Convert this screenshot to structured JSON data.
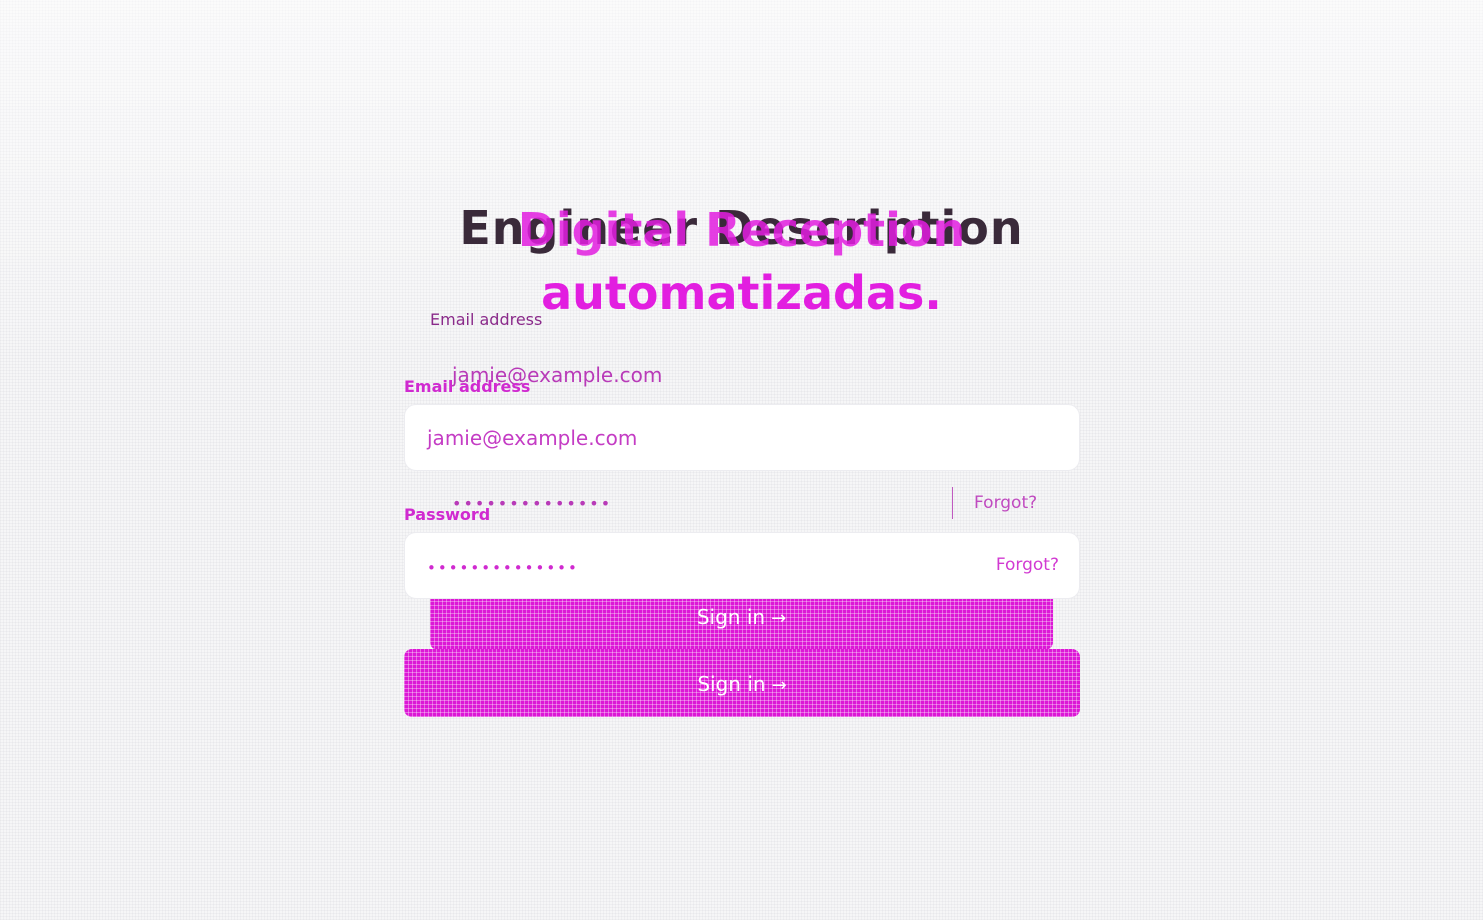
{
  "title": {
    "back_line": "Engineer Description",
    "front_line": "Digital Reception",
    "sub_line": "automatizadas."
  },
  "form": {
    "email": {
      "label": "Email address",
      "value": "jamie@example.com"
    },
    "password": {
      "label": "Password",
      "masked_value": "••••••••••••••",
      "forgot_label": "Forgot?"
    },
    "submit": {
      "label": "Sign in",
      "arrow": "→"
    }
  },
  "colors": {
    "accent": "#dc18d6",
    "background": "#f6f6f7",
    "input_bg": "#ffffff"
  },
  "icons": {
    "submit_arrow": "arrow-right-icon"
  }
}
